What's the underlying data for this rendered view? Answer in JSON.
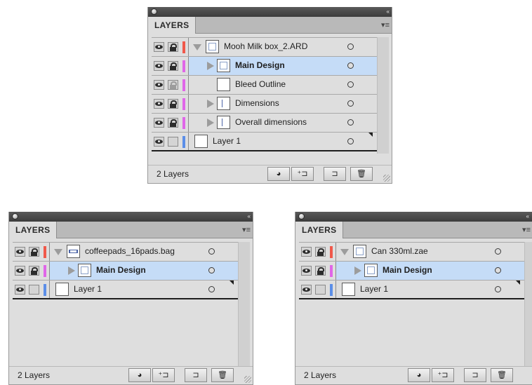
{
  "tab_label": "LAYERS",
  "icons": {
    "collapse": "«",
    "menu": "▾≡",
    "make_clipping_mask": "◕",
    "create_sublayer": "⁺⊐",
    "new_layer": "⊐",
    "delete_layer": "🗑"
  },
  "colors": {
    "red": "#f0584a",
    "magenta": "#e066e8",
    "blue": "#5b8ee8",
    "selection": "#c5dcf7"
  },
  "panels": [
    {
      "footer_text": "2 Layers",
      "layers": [
        {
          "name": "Mooh Milk box_2.ARD",
          "color": "red",
          "depth": 0,
          "disclosure": "expanded",
          "lock": "on",
          "selected": false,
          "bold": false
        },
        {
          "name": "Main Design",
          "color": "magenta",
          "depth": 1,
          "disclosure": "collapsed",
          "lock": "on",
          "selected": true,
          "bold": true
        },
        {
          "name": "Bleed Outline",
          "color": "magenta",
          "depth": 1,
          "disclosure": "none",
          "lock": "dim",
          "selected": false,
          "bold": false
        },
        {
          "name": "Dimensions",
          "color": "magenta",
          "depth": 1,
          "disclosure": "collapsed",
          "lock": "on",
          "selected": false,
          "bold": false
        },
        {
          "name": "Overall dimensions",
          "color": "magenta",
          "depth": 1,
          "disclosure": "collapsed",
          "lock": "on",
          "selected": false,
          "bold": false
        },
        {
          "name": "Layer 1",
          "color": "blue",
          "depth": 0,
          "disclosure": "none",
          "lock": "off",
          "selected": false,
          "bold": false
        }
      ]
    },
    {
      "footer_text": "2 Layers",
      "layers": [
        {
          "name": "coffeepads_16pads.bag",
          "color": "red",
          "depth": 0,
          "disclosure": "expanded",
          "lock": "on",
          "selected": false,
          "bold": false
        },
        {
          "name": "Main Design",
          "color": "magenta",
          "depth": 1,
          "disclosure": "collapsed",
          "lock": "on",
          "selected": true,
          "bold": true
        },
        {
          "name": "Layer 1",
          "color": "blue",
          "depth": 0,
          "disclosure": "none",
          "lock": "off",
          "selected": false,
          "bold": false
        }
      ]
    },
    {
      "footer_text": "2 Layers",
      "layers": [
        {
          "name": "Can 330ml.zae",
          "color": "red",
          "depth": 0,
          "disclosure": "expanded",
          "lock": "on",
          "selected": false,
          "bold": false
        },
        {
          "name": "Main Design",
          "color": "magenta",
          "depth": 1,
          "disclosure": "collapsed",
          "lock": "on",
          "selected": true,
          "bold": true
        },
        {
          "name": "Layer 1",
          "color": "blue",
          "depth": 0,
          "disclosure": "none",
          "lock": "off",
          "selected": false,
          "bold": false
        }
      ]
    }
  ]
}
